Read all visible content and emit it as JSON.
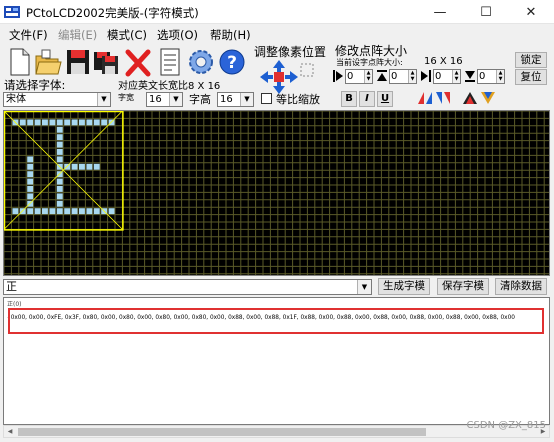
{
  "window": {
    "title": "PCtoLCD2002完美版-(字符模式)",
    "minimize": "—",
    "maximize": "☐",
    "close": "✕"
  },
  "menu": [
    {
      "label": "文件(F)",
      "enabled": true
    },
    {
      "label": "编辑(E)",
      "enabled": false
    },
    {
      "label": "模式(C)",
      "enabled": true
    },
    {
      "label": "选项(O)",
      "enabled": true
    },
    {
      "label": "帮助(H)",
      "enabled": true
    }
  ],
  "toolbar": {
    "icons": [
      "new-file-icon",
      "open-folder-icon",
      "save-icon",
      "save-as-icon",
      "delete-icon",
      "document-icon",
      "settings-icon",
      "help-icon"
    ],
    "pixel_adjust": {
      "title": "调整像素位置"
    },
    "dot_matrix": {
      "title": "修改点阵大小",
      "current_label": "当前设字点阵大小:",
      "current_value": "16 X 16",
      "lock_label": "锁定",
      "restore_label": "复位",
      "spin_values": [
        "0",
        "0",
        "0",
        "0"
      ]
    },
    "font_label": "请选择字体:",
    "font_value": "宋体",
    "width_hint": "对应英文长宽比8 X 16",
    "char_width_label": "字宽",
    "char_width_value": "16",
    "char_height_label": "字高",
    "char_height_value": "16",
    "proportional_label": "等比缩放",
    "bold": "B",
    "italic": "I",
    "underline": "U"
  },
  "editor": {
    "char_input": "正",
    "generate_label": "生成字模",
    "save_label": "保存字模",
    "clear_label": "清除数据"
  },
  "output": {
    "header": "正(0)",
    "code": "{0x00, 0x00, 0xFE, 0x3F, 0x80, 0x00, 0x80, 0x00, 0x80, 0x00, 0x80, 0x00, 0x88, 0x00, 0x88, 0x1F, 0x88, 0x00, 0x88, 0x00, 0x88, 0x00, 0x88, 0x00, 0x88, 0x00, 0x88, 0x00"
  },
  "watermark": "CSDN @ZX_815",
  "colors": {
    "grid_bg": "#000000",
    "grid_line": "#5a5a28",
    "pixel_on": "#a8d8f0",
    "frame": "#ffff00",
    "highlight": "#e03131"
  },
  "glyph_bitmap": [
    "0000000000000000",
    "0111111111111110",
    "0000000100000000",
    "0000000100000000",
    "0000000100000000",
    "0000000100000000",
    "0001000100000000",
    "0001000111111000",
    "0001000100000000",
    "0001000100000000",
    "0001000100000000",
    "0001000100000000",
    "0001000100000000",
    "0111111111111110",
    "0000000000000000",
    "0000000000000000"
  ]
}
